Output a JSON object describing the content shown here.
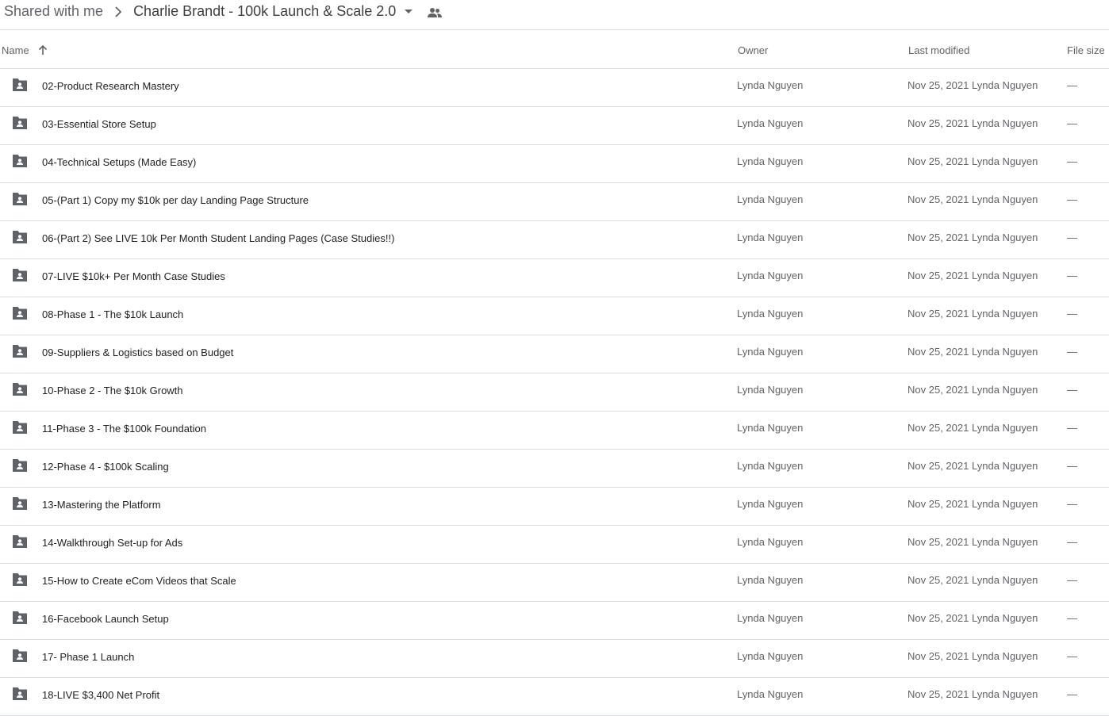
{
  "breadcrumb": {
    "root": "Shared with me",
    "current": "Charlie Brandt - 100k Launch & Scale 2.0",
    "separator_icon": "chevron-right-icon",
    "dropdown_icon": "caret-down-icon",
    "shared_icon": "people-icon"
  },
  "columns": {
    "name": "Name",
    "owner": "Owner",
    "last_modified": "Last modified",
    "file_size": "File size",
    "sort_icon": "arrow-up-icon"
  },
  "colors": {
    "folder_icon": "#5f6368",
    "text_primary": "#202124",
    "text_secondary": "#5f6368",
    "divider": "#dadce0"
  },
  "rows": [
    {
      "name": "02-Product Research Mastery",
      "owner": "Lynda Nguyen",
      "date": "Nov 25, 2021",
      "modified_by": "Lynda Nguyen",
      "size": "—"
    },
    {
      "name": "03-Essential Store Setup",
      "owner": "Lynda Nguyen",
      "date": "Nov 25, 2021",
      "modified_by": "Lynda Nguyen",
      "size": "—"
    },
    {
      "name": "04-Technical Setups (Made Easy)",
      "owner": "Lynda Nguyen",
      "date": "Nov 25, 2021",
      "modified_by": "Lynda Nguyen",
      "size": "—"
    },
    {
      "name": "05-(Part 1) Copy my $10k per day Landing Page Structure",
      "owner": "Lynda Nguyen",
      "date": "Nov 25, 2021",
      "modified_by": "Lynda Nguyen",
      "size": "—"
    },
    {
      "name": "06-(Part 2) See LIVE 10k Per Month Student Landing Pages (Case Studies!!)",
      "owner": "Lynda Nguyen",
      "date": "Nov 25, 2021",
      "modified_by": "Lynda Nguyen",
      "size": "—"
    },
    {
      "name": "07-LIVE $10k+ Per Month Case Studies",
      "owner": "Lynda Nguyen",
      "date": "Nov 25, 2021",
      "modified_by": "Lynda Nguyen",
      "size": "—"
    },
    {
      "name": "08-Phase 1 - The $10k Launch",
      "owner": "Lynda Nguyen",
      "date": "Nov 25, 2021",
      "modified_by": "Lynda Nguyen",
      "size": "—"
    },
    {
      "name": "09-Suppliers & Logistics based on Budget",
      "owner": "Lynda Nguyen",
      "date": "Nov 25, 2021",
      "modified_by": "Lynda Nguyen",
      "size": "—"
    },
    {
      "name": "10-Phase 2 - The $10k Growth",
      "owner": "Lynda Nguyen",
      "date": "Nov 25, 2021",
      "modified_by": "Lynda Nguyen",
      "size": "—"
    },
    {
      "name": "11-Phase 3 - The $100k Foundation",
      "owner": "Lynda Nguyen",
      "date": "Nov 25, 2021",
      "modified_by": "Lynda Nguyen",
      "size": "—"
    },
    {
      "name": "12-Phase 4 - $100k Scaling",
      "owner": "Lynda Nguyen",
      "date": "Nov 25, 2021",
      "modified_by": "Lynda Nguyen",
      "size": "—"
    },
    {
      "name": "13-Mastering the Platform",
      "owner": "Lynda Nguyen",
      "date": "Nov 25, 2021",
      "modified_by": "Lynda Nguyen",
      "size": "—"
    },
    {
      "name": "14-Walkthrough Set-up for Ads",
      "owner": "Lynda Nguyen",
      "date": "Nov 25, 2021",
      "modified_by": "Lynda Nguyen",
      "size": "—"
    },
    {
      "name": "15-How to Create eCom Videos that Scale",
      "owner": "Lynda Nguyen",
      "date": "Nov 25, 2021",
      "modified_by": "Lynda Nguyen",
      "size": "—"
    },
    {
      "name": "16-Facebook Launch Setup",
      "owner": "Lynda Nguyen",
      "date": "Nov 25, 2021",
      "modified_by": "Lynda Nguyen",
      "size": "—"
    },
    {
      "name": "17- Phase 1 Launch",
      "owner": "Lynda Nguyen",
      "date": "Nov 25, 2021",
      "modified_by": "Lynda Nguyen",
      "size": "—"
    },
    {
      "name": "18-LIVE $3,400 Net Profit",
      "owner": "Lynda Nguyen",
      "date": "Nov 25, 2021",
      "modified_by": "Lynda Nguyen",
      "size": "—"
    }
  ]
}
